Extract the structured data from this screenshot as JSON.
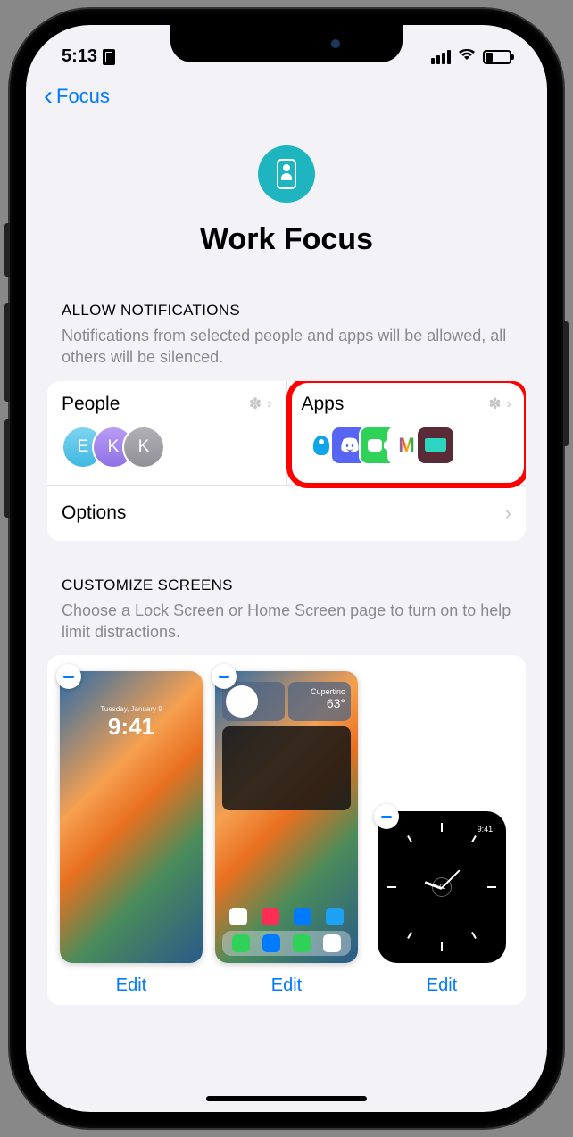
{
  "status_bar": {
    "time": "5:13"
  },
  "nav": {
    "back_label": "Focus"
  },
  "header": {
    "title": "Work Focus"
  },
  "notifications": {
    "section_title": "ALLOW NOTIFICATIONS",
    "section_desc": "Notifications from selected people and apps will be allowed, all others will be silenced.",
    "people": {
      "label": "People",
      "avatars": [
        "E",
        "K",
        "K"
      ]
    },
    "apps": {
      "label": "Apps"
    },
    "options_label": "Options"
  },
  "customize": {
    "section_title": "CUSTOMIZE SCREENS",
    "section_desc": "Choose a Lock Screen or Home Screen page to turn on to help limit distractions.",
    "lock_screen": {
      "date": "Tuesday, January 9",
      "time": "9:41"
    },
    "home_screen": {
      "weather_loc": "Cupertino",
      "weather_temp": "63°"
    },
    "edit_label": "Edit"
  }
}
